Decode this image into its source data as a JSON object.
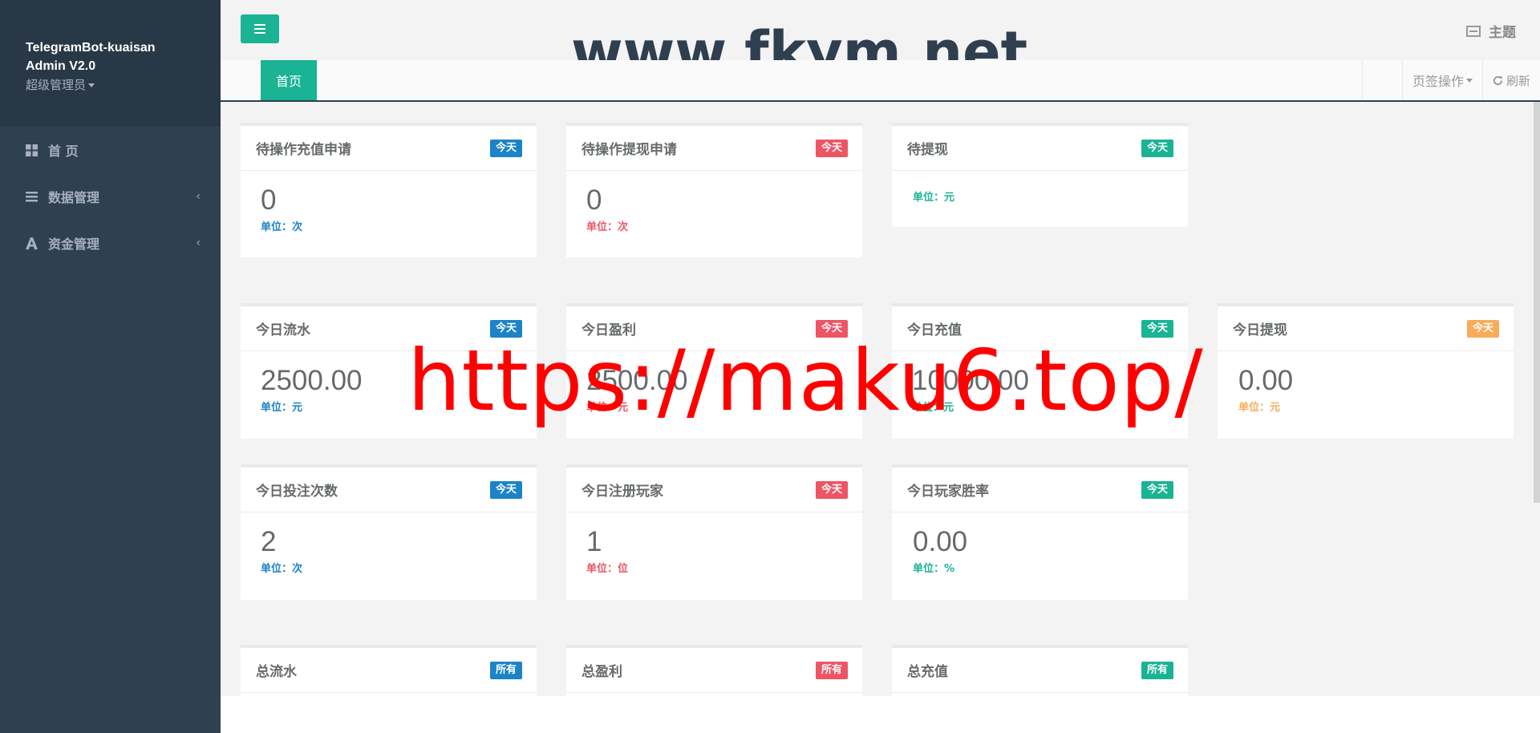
{
  "sidebar": {
    "brand_line1": "TelegramBot-kuaisan",
    "brand_line2": "Admin V2.0",
    "role": "超级管理员",
    "items": [
      {
        "label": "首 页",
        "icon": "dashboard-grid-icon"
      },
      {
        "label": "数据管理",
        "icon": "list-icon",
        "arrow": "‹"
      },
      {
        "label": "资金管理",
        "icon": "font-a-icon",
        "arrow": "‹"
      }
    ]
  },
  "topbar": {
    "theme_label": "主题",
    "watermark": "www.fkym.net"
  },
  "tabs": {
    "home": "首页",
    "page_actions": "页签操作",
    "refresh": "刷新"
  },
  "overlay_watermark": "https://maku6.top/",
  "cards": {
    "r1": [
      {
        "title": "待操作充值申请",
        "badge": "今天",
        "color": "blue",
        "value": "0",
        "unit": "单位：次"
      },
      {
        "title": "待操作提现申请",
        "badge": "今天",
        "color": "red",
        "value": "0",
        "unit": "单位：次"
      },
      {
        "title": "待提现",
        "badge": "今天",
        "color": "green",
        "value": "",
        "unit": "单位：元"
      }
    ],
    "r2": [
      {
        "title": "今日流水",
        "badge": "今天",
        "color": "blue",
        "value": "2500.00",
        "unit": "单位：元"
      },
      {
        "title": "今日盈利",
        "badge": "今天",
        "color": "red",
        "value": "2500.00",
        "unit": "单位：元"
      },
      {
        "title": "今日充值",
        "badge": "今天",
        "color": "green",
        "value": "10000.00",
        "unit": "单位：元"
      },
      {
        "title": "今日提现",
        "badge": "今天",
        "color": "yellow",
        "value": "0.00",
        "unit": "单位：元"
      }
    ],
    "r3": [
      {
        "title": "今日投注次数",
        "badge": "今天",
        "color": "blue",
        "value": "2",
        "unit": "单位：次"
      },
      {
        "title": "今日注册玩家",
        "badge": "今天",
        "color": "red",
        "value": "1",
        "unit": "单位：位"
      },
      {
        "title": "今日玩家胜率",
        "badge": "今天",
        "color": "green",
        "value": "0.00",
        "unit": "单位：%"
      }
    ],
    "r4": [
      {
        "title": "总流水",
        "badge": "所有",
        "color": "blue"
      },
      {
        "title": "总盈利",
        "badge": "所有",
        "color": "red"
      },
      {
        "title": "总充值",
        "badge": "所有",
        "color": "green"
      }
    ]
  },
  "colors": {
    "sidebar_bg": "#2f4050",
    "accent": "#1ab394",
    "blue": "#1c84c6",
    "red": "#ed5565",
    "yellow": "#f8ac59"
  }
}
